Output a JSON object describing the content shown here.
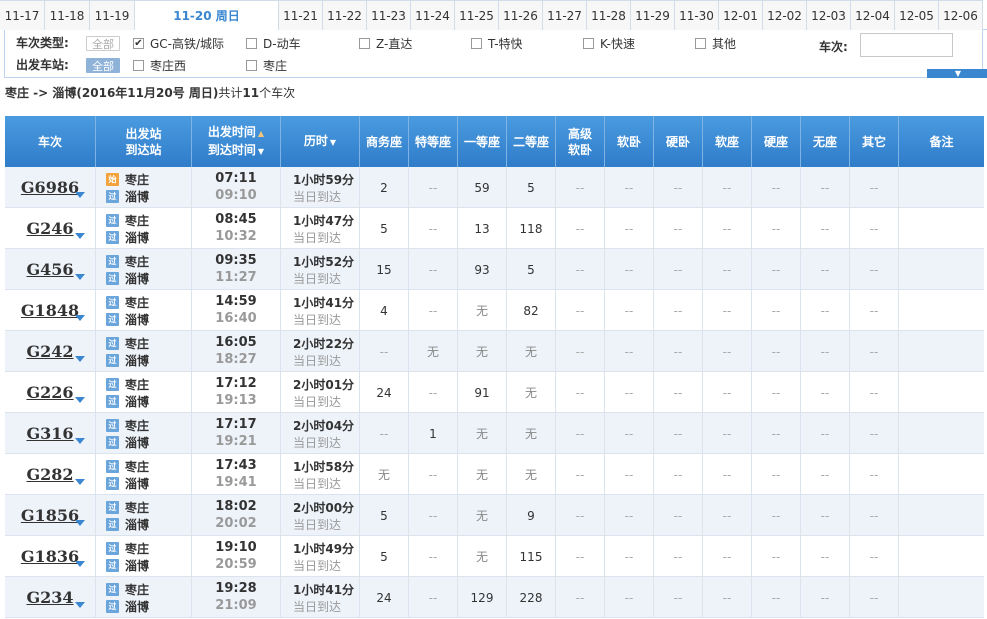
{
  "dates": [
    {
      "label": "11-17",
      "active": false
    },
    {
      "label": "11-18",
      "active": false
    },
    {
      "label": "11-19",
      "active": false
    },
    {
      "label": "11-20 周日",
      "active": true
    },
    {
      "label": "11-21",
      "active": false
    },
    {
      "label": "11-22",
      "active": false
    },
    {
      "label": "11-23",
      "active": false
    },
    {
      "label": "11-24",
      "active": false
    },
    {
      "label": "11-25",
      "active": false
    },
    {
      "label": "11-26",
      "active": false
    },
    {
      "label": "11-27",
      "active": false
    },
    {
      "label": "11-28",
      "active": false
    },
    {
      "label": "11-29",
      "active": false
    },
    {
      "label": "11-30",
      "active": false
    },
    {
      "label": "12-01",
      "active": false
    },
    {
      "label": "12-02",
      "active": false
    },
    {
      "label": "12-03",
      "active": false
    },
    {
      "label": "12-04",
      "active": false
    },
    {
      "label": "12-05",
      "active": false
    },
    {
      "label": "12-06",
      "active": false
    }
  ],
  "filters": {
    "type_label": "车次类型:",
    "station_label": "出发车站:",
    "all_label": "全部",
    "types": [
      {
        "label": "GC-高铁/城际",
        "checked": true
      },
      {
        "label": "D-动车",
        "checked": false
      },
      {
        "label": "Z-直达",
        "checked": false
      },
      {
        "label": "T-特快",
        "checked": false
      },
      {
        "label": "K-快速",
        "checked": false
      },
      {
        "label": "其他",
        "checked": false
      }
    ],
    "stations": [
      {
        "label": "枣庄西",
        "checked": false
      },
      {
        "label": "枣庄",
        "checked": false
      }
    ],
    "trainno_label": "车次:",
    "trainno_value": ""
  },
  "summary": {
    "route": "枣庄 -> 淄博",
    "date": "(2016年11月20号 周日)",
    "prefix": "共计",
    "count": "11",
    "suffix": "个车次"
  },
  "headers": {
    "train": "车次",
    "from": "出发站",
    "to": "到达站",
    "dep": "出发时间",
    "arr": "到达时间",
    "dur": "历时",
    "business": "商务座",
    "special": "特等座",
    "first": "一等座",
    "second": "二等座",
    "hs1": "高级",
    "hs2": "软卧",
    "soft_sleeper": "软卧",
    "hard_sleeper": "硬卧",
    "soft_seat": "软座",
    "hard_seat": "硬座",
    "no_seat": "无座",
    "other": "其它",
    "note": "备注"
  },
  "icons": {
    "start": "始",
    "pass": "过"
  },
  "rows": [
    {
      "no": "G6986",
      "from": "枣庄",
      "to": "淄博",
      "start": true,
      "dep": "07:11",
      "arr": "09:10",
      "dur": "1小时59分",
      "day": "当日到达",
      "seats": [
        "2",
        "--",
        "59",
        "5",
        "--",
        "--",
        "--",
        "--",
        "--",
        "--",
        "--"
      ]
    },
    {
      "no": "G246",
      "from": "枣庄",
      "to": "淄博",
      "start": false,
      "dep": "08:45",
      "arr": "10:32",
      "dur": "1小时47分",
      "day": "当日到达",
      "seats": [
        "5",
        "--",
        "13",
        "118",
        "--",
        "--",
        "--",
        "--",
        "--",
        "--",
        "--"
      ]
    },
    {
      "no": "G456",
      "from": "枣庄",
      "to": "淄博",
      "start": false,
      "dep": "09:35",
      "arr": "11:27",
      "dur": "1小时52分",
      "day": "当日到达",
      "seats": [
        "15",
        "--",
        "93",
        "5",
        "--",
        "--",
        "--",
        "--",
        "--",
        "--",
        "--"
      ]
    },
    {
      "no": "G1848",
      "from": "枣庄",
      "to": "淄博",
      "start": false,
      "dep": "14:59",
      "arr": "16:40",
      "dur": "1小时41分",
      "day": "当日到达",
      "seats": [
        "4",
        "--",
        "无",
        "82",
        "--",
        "--",
        "--",
        "--",
        "--",
        "--",
        "--"
      ]
    },
    {
      "no": "G242",
      "from": "枣庄",
      "to": "淄博",
      "start": false,
      "dep": "16:05",
      "arr": "18:27",
      "dur": "2小时22分",
      "day": "当日到达",
      "seats": [
        "--",
        "无",
        "无",
        "无",
        "--",
        "--",
        "--",
        "--",
        "--",
        "--",
        "--"
      ]
    },
    {
      "no": "G226",
      "from": "枣庄",
      "to": "淄博",
      "start": false,
      "dep": "17:12",
      "arr": "19:13",
      "dur": "2小时01分",
      "day": "当日到达",
      "seats": [
        "24",
        "--",
        "91",
        "无",
        "--",
        "--",
        "--",
        "--",
        "--",
        "--",
        "--"
      ]
    },
    {
      "no": "G316",
      "from": "枣庄",
      "to": "淄博",
      "start": false,
      "dep": "17:17",
      "arr": "19:21",
      "dur": "2小时04分",
      "day": "当日到达",
      "seats": [
        "--",
        "1",
        "无",
        "无",
        "--",
        "--",
        "--",
        "--",
        "--",
        "--",
        "--"
      ]
    },
    {
      "no": "G282",
      "from": "枣庄",
      "to": "淄博",
      "start": false,
      "dep": "17:43",
      "arr": "19:41",
      "dur": "1小时58分",
      "day": "当日到达",
      "seats": [
        "无",
        "--",
        "无",
        "无",
        "--",
        "--",
        "--",
        "--",
        "--",
        "--",
        "--"
      ]
    },
    {
      "no": "G1856",
      "from": "枣庄",
      "to": "淄博",
      "start": false,
      "dep": "18:02",
      "arr": "20:02",
      "dur": "2小时00分",
      "day": "当日到达",
      "seats": [
        "5",
        "--",
        "无",
        "9",
        "--",
        "--",
        "--",
        "--",
        "--",
        "--",
        "--"
      ]
    },
    {
      "no": "G1836",
      "from": "枣庄",
      "to": "淄博",
      "start": false,
      "dep": "19:10",
      "arr": "20:59",
      "dur": "1小时49分",
      "day": "当日到达",
      "seats": [
        "5",
        "--",
        "无",
        "115",
        "--",
        "--",
        "--",
        "--",
        "--",
        "--",
        "--"
      ]
    },
    {
      "no": "G234",
      "from": "枣庄",
      "to": "淄博",
      "start": false,
      "dep": "19:28",
      "arr": "21:09",
      "dur": "1小时41分",
      "day": "当日到达",
      "seats": [
        "24",
        "--",
        "129",
        "228",
        "--",
        "--",
        "--",
        "--",
        "--",
        "--",
        "--"
      ]
    }
  ]
}
